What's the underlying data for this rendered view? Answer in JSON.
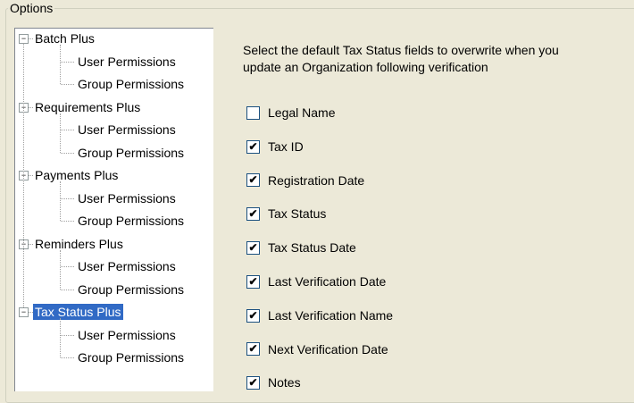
{
  "group_title": "Options",
  "tree": {
    "groups": [
      {
        "label": "Batch Plus",
        "expander": "−",
        "children": [
          "User Permissions",
          "Group Permissions"
        ]
      },
      {
        "label": "Requirements Plus",
        "expander": "−",
        "children": [
          "User Permissions",
          "Group Permissions"
        ]
      },
      {
        "label": "Payments Plus",
        "expander": "−",
        "children": [
          "User Permissions",
          "Group Permissions"
        ]
      },
      {
        "label": "Reminders Plus",
        "expander": "−",
        "children": [
          "User Permissions",
          "Group Permissions"
        ]
      },
      {
        "label": "Tax Status Plus",
        "expander": "−",
        "selected": true,
        "children": [
          "User Permissions",
          "Group Permissions"
        ]
      }
    ]
  },
  "panel": {
    "instructions": "Select the default Tax Status fields to overwrite when you\nupdate an Organization following verification",
    "checkboxes": [
      {
        "label": "Legal Name",
        "checked": false
      },
      {
        "label": "Tax ID",
        "checked": true
      },
      {
        "label": "Registration Date",
        "checked": true
      },
      {
        "label": "Tax Status",
        "checked": true
      },
      {
        "label": "Tax Status Date",
        "checked": true
      },
      {
        "label": "Last Verification Date",
        "checked": true
      },
      {
        "label": "Last Verification Name",
        "checked": true
      },
      {
        "label": "Next Verification Date",
        "checked": true
      },
      {
        "label": "Notes",
        "checked": true
      }
    ],
    "check_glyph": "✔"
  }
}
